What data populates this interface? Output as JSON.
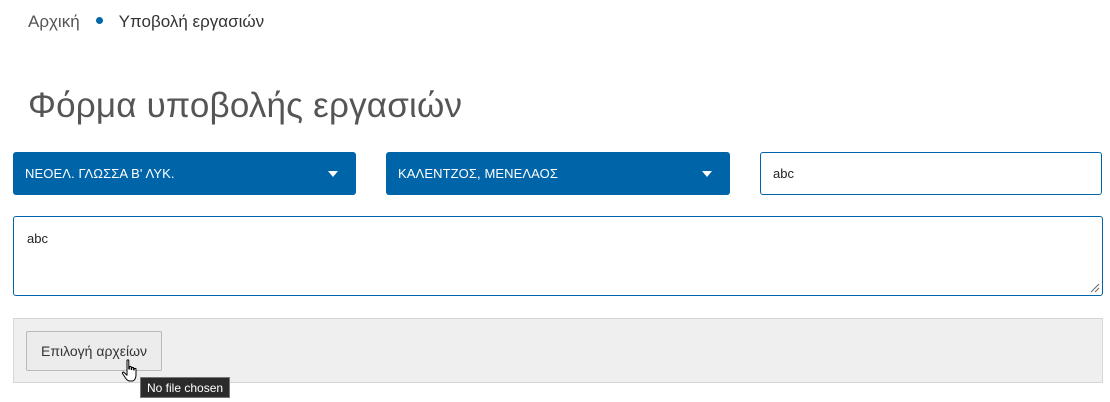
{
  "breadcrumb": {
    "home_label": "Αρχική",
    "current_label": "Υποβολή εργασιών"
  },
  "page_title": "Φόρμα υποβολής εργασιών",
  "form": {
    "course_select": {
      "selected": "ΝΕΟΕΛ. ΓΛΩΣΣΑ Β' ΛΥΚ."
    },
    "teacher_select": {
      "selected": "ΚΑΛΕΝΤΖΟΣ, ΜΕΝΕΛΑΟΣ"
    },
    "title_input": {
      "value": "abc"
    },
    "description_textarea": {
      "value": "abc"
    },
    "file_input": {
      "button_label": "Επιλογή αρχείων",
      "tooltip": "No file chosen"
    }
  },
  "colors": {
    "accent": "#0065a8",
    "panel_bg": "#efefef"
  }
}
